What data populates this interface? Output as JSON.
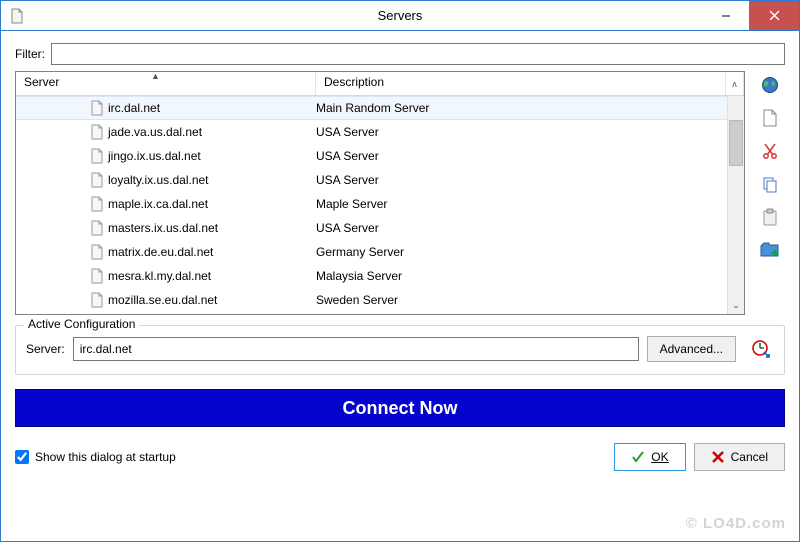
{
  "window": {
    "title": "Servers"
  },
  "filter": {
    "label": "Filter:",
    "value": ""
  },
  "columns": {
    "server": "Server",
    "description": "Description"
  },
  "servers": [
    {
      "host": "irc.dal.net",
      "desc": "Main Random Server",
      "selected": true
    },
    {
      "host": "jade.va.us.dal.net",
      "desc": "USA Server"
    },
    {
      "host": "jingo.ix.us.dal.net",
      "desc": "USA Server"
    },
    {
      "host": "loyalty.ix.us.dal.net",
      "desc": "USA Server"
    },
    {
      "host": "maple.ix.ca.dal.net",
      "desc": "Maple Server"
    },
    {
      "host": "masters.ix.us.dal.net",
      "desc": "USA Server"
    },
    {
      "host": "matrix.de.eu.dal.net",
      "desc": "Germany Server"
    },
    {
      "host": "mesra.kl.my.dal.net",
      "desc": "Malaysia Server"
    },
    {
      "host": "mozilla.se.eu.dal.net",
      "desc": "Sweden Server"
    }
  ],
  "active": {
    "legend": "Active Configuration",
    "server_label": "Server:",
    "server_value": "irc.dal.net",
    "advanced_label": "Advanced..."
  },
  "connect_label": "Connect Now",
  "startup_checkbox": {
    "label": "Show this dialog at startup",
    "checked": true
  },
  "buttons": {
    "ok": "OK",
    "cancel": "Cancel"
  },
  "watermark": "© LO4D.com"
}
